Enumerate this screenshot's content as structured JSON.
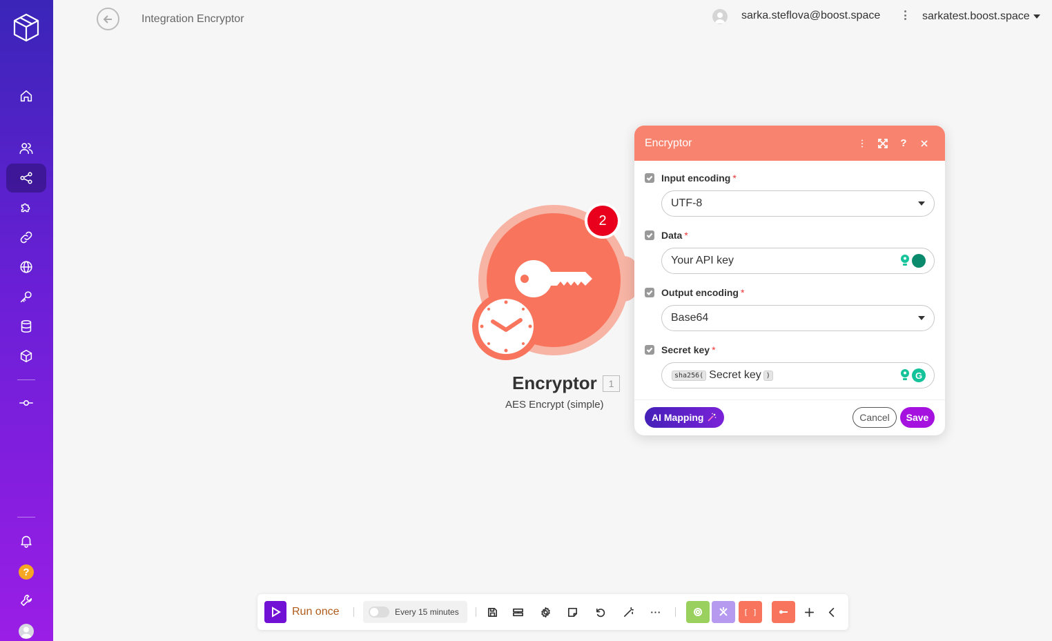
{
  "header": {
    "title": "Integration Encryptor",
    "user_email": "sarka.steflova@boost.space",
    "org": "sarkatest.boost.space"
  },
  "module": {
    "name": "Encryptor",
    "id": "1",
    "subtitle": "AES Encrypt (simple)",
    "badge_count": "2",
    "color": "#f8745c"
  },
  "dialog": {
    "title": "Encryptor",
    "fields": [
      {
        "label": "Input encoding",
        "required": "*",
        "value": "UTF-8"
      },
      {
        "label": "Data",
        "required": "*",
        "value": "Your API key"
      },
      {
        "label": "Output encoding",
        "required": "*",
        "value": "Base64"
      },
      {
        "label": "Secret key",
        "required": "*",
        "fn_open": "sha256(",
        "value": "Secret key",
        "fn_close": ")"
      }
    ],
    "ai_mapping": "AI Mapping",
    "cancel": "Cancel",
    "save": "Save"
  },
  "toolbar": {
    "run_once": "Run once",
    "schedule": "Every 15 minutes"
  },
  "sidebar": {
    "help": "?"
  }
}
